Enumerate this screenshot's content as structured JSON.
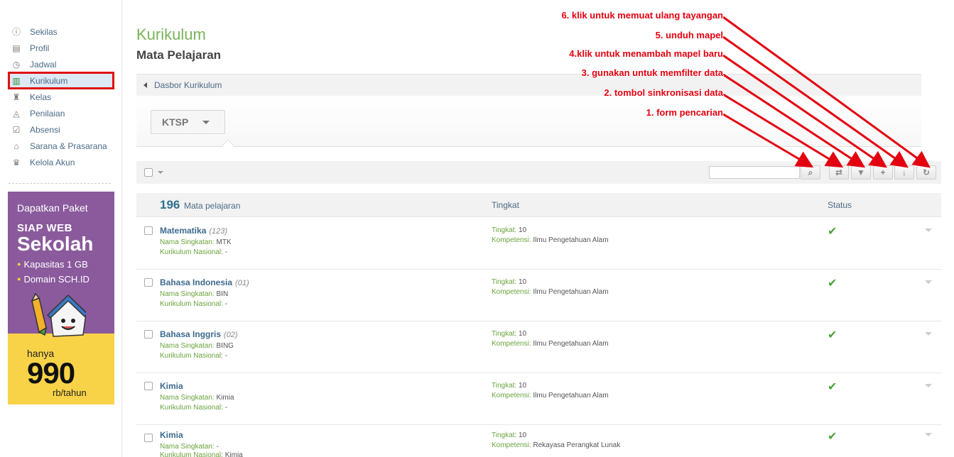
{
  "sidebar": {
    "items": [
      {
        "label": "Sekilas",
        "icon": "info-icon",
        "glyph": "ⓘ"
      },
      {
        "label": "Profil",
        "icon": "id-card-icon",
        "glyph": "▤"
      },
      {
        "label": "Jadwal",
        "icon": "calendar-clock-icon",
        "glyph": "◷"
      },
      {
        "label": "Kurikulum",
        "icon": "book-icon",
        "glyph": "▥"
      },
      {
        "label": "Kelas",
        "icon": "desk-chair-icon",
        "glyph": "♜"
      },
      {
        "label": "Penilaian",
        "icon": "chart-icon",
        "glyph": "◬"
      },
      {
        "label": "Absensi",
        "icon": "checklist-icon",
        "glyph": "☑"
      },
      {
        "label": "Sarana & Prasarana",
        "icon": "building-icon",
        "glyph": "⌂"
      },
      {
        "label": "Kelola Akun",
        "icon": "crown-icon",
        "glyph": "♛"
      }
    ],
    "active_index": 3
  },
  "promo": {
    "line1": "Dapatkan Paket",
    "line2": "SIAP WEB",
    "line3": "Sekolah",
    "bullet1": "Kapasitas 1 GB",
    "bullet2": "Domain SCH.ID",
    "hanya": "hanya",
    "price": "990",
    "unit": "rb/tahun"
  },
  "header": {
    "title": "Kurikulum",
    "subtitle": "Mata Pelajaran",
    "breadcrumb": "Dasbor Kurikulum"
  },
  "tab": {
    "label": "KTSP"
  },
  "toolbar": {
    "search_placeholder": "",
    "search_glyph": "⌕",
    "sync_glyph": "⇄",
    "filter_glyph": "▼",
    "add_glyph": "+",
    "download_glyph": "↓",
    "reload_glyph": "↻"
  },
  "table": {
    "count": "196",
    "count_label": "Mata pelajaran",
    "col_tingkat": "Tingkat",
    "col_status": "Status",
    "label_nama_singkatan": "Nama Singkatan:",
    "label_kurikulum_nasional": "Kurikulum Nasional:",
    "label_tingkat": "Tingkat:",
    "label_kompetensi": "Kompetensi:",
    "status_glyph": "✔",
    "rows": [
      {
        "name": "Matematika",
        "code": "(123)",
        "singkatan": "MTK",
        "nasional": "-",
        "tingkat": "10",
        "kompetensi": "Ilmu Pengetahuan Alam"
      },
      {
        "name": "Bahasa Indonesia",
        "code": "(01)",
        "singkatan": "BIN",
        "nasional": "-",
        "tingkat": "10",
        "kompetensi": "Ilmu Pengetahuan Alam"
      },
      {
        "name": "Bahasa Inggris",
        "code": "(02)",
        "singkatan": "BING",
        "nasional": "-",
        "tingkat": "10",
        "kompetensi": "Ilmu Pengetahuan Alam"
      },
      {
        "name": "Kimia",
        "code": "",
        "singkatan": "Kimia",
        "nasional": "-",
        "tingkat": "10",
        "kompetensi": "Ilmu Pengetahuan Alam"
      },
      {
        "name": "Kimia",
        "code": "",
        "singkatan": "-",
        "nasional": "Kimia",
        "tingkat": "10",
        "kompetensi": "Rekayasa Perangkat Lunak"
      }
    ]
  },
  "annotations": [
    "6. klik untuk memuat ulang tayangan",
    "5. unduh mapel",
    "4.klik untuk menambah mapel baru",
    "3. gunakan untuk memfilter data",
    "2. tombol sinkronisasi data",
    "1. form pencarian"
  ],
  "colors": {
    "accent_green": "#7ab25a",
    "link_blue": "#4c6a86",
    "annotation_red": "#e3000f",
    "promo_purple": "#8a5a9c",
    "promo_yellow": "#f8d348"
  }
}
